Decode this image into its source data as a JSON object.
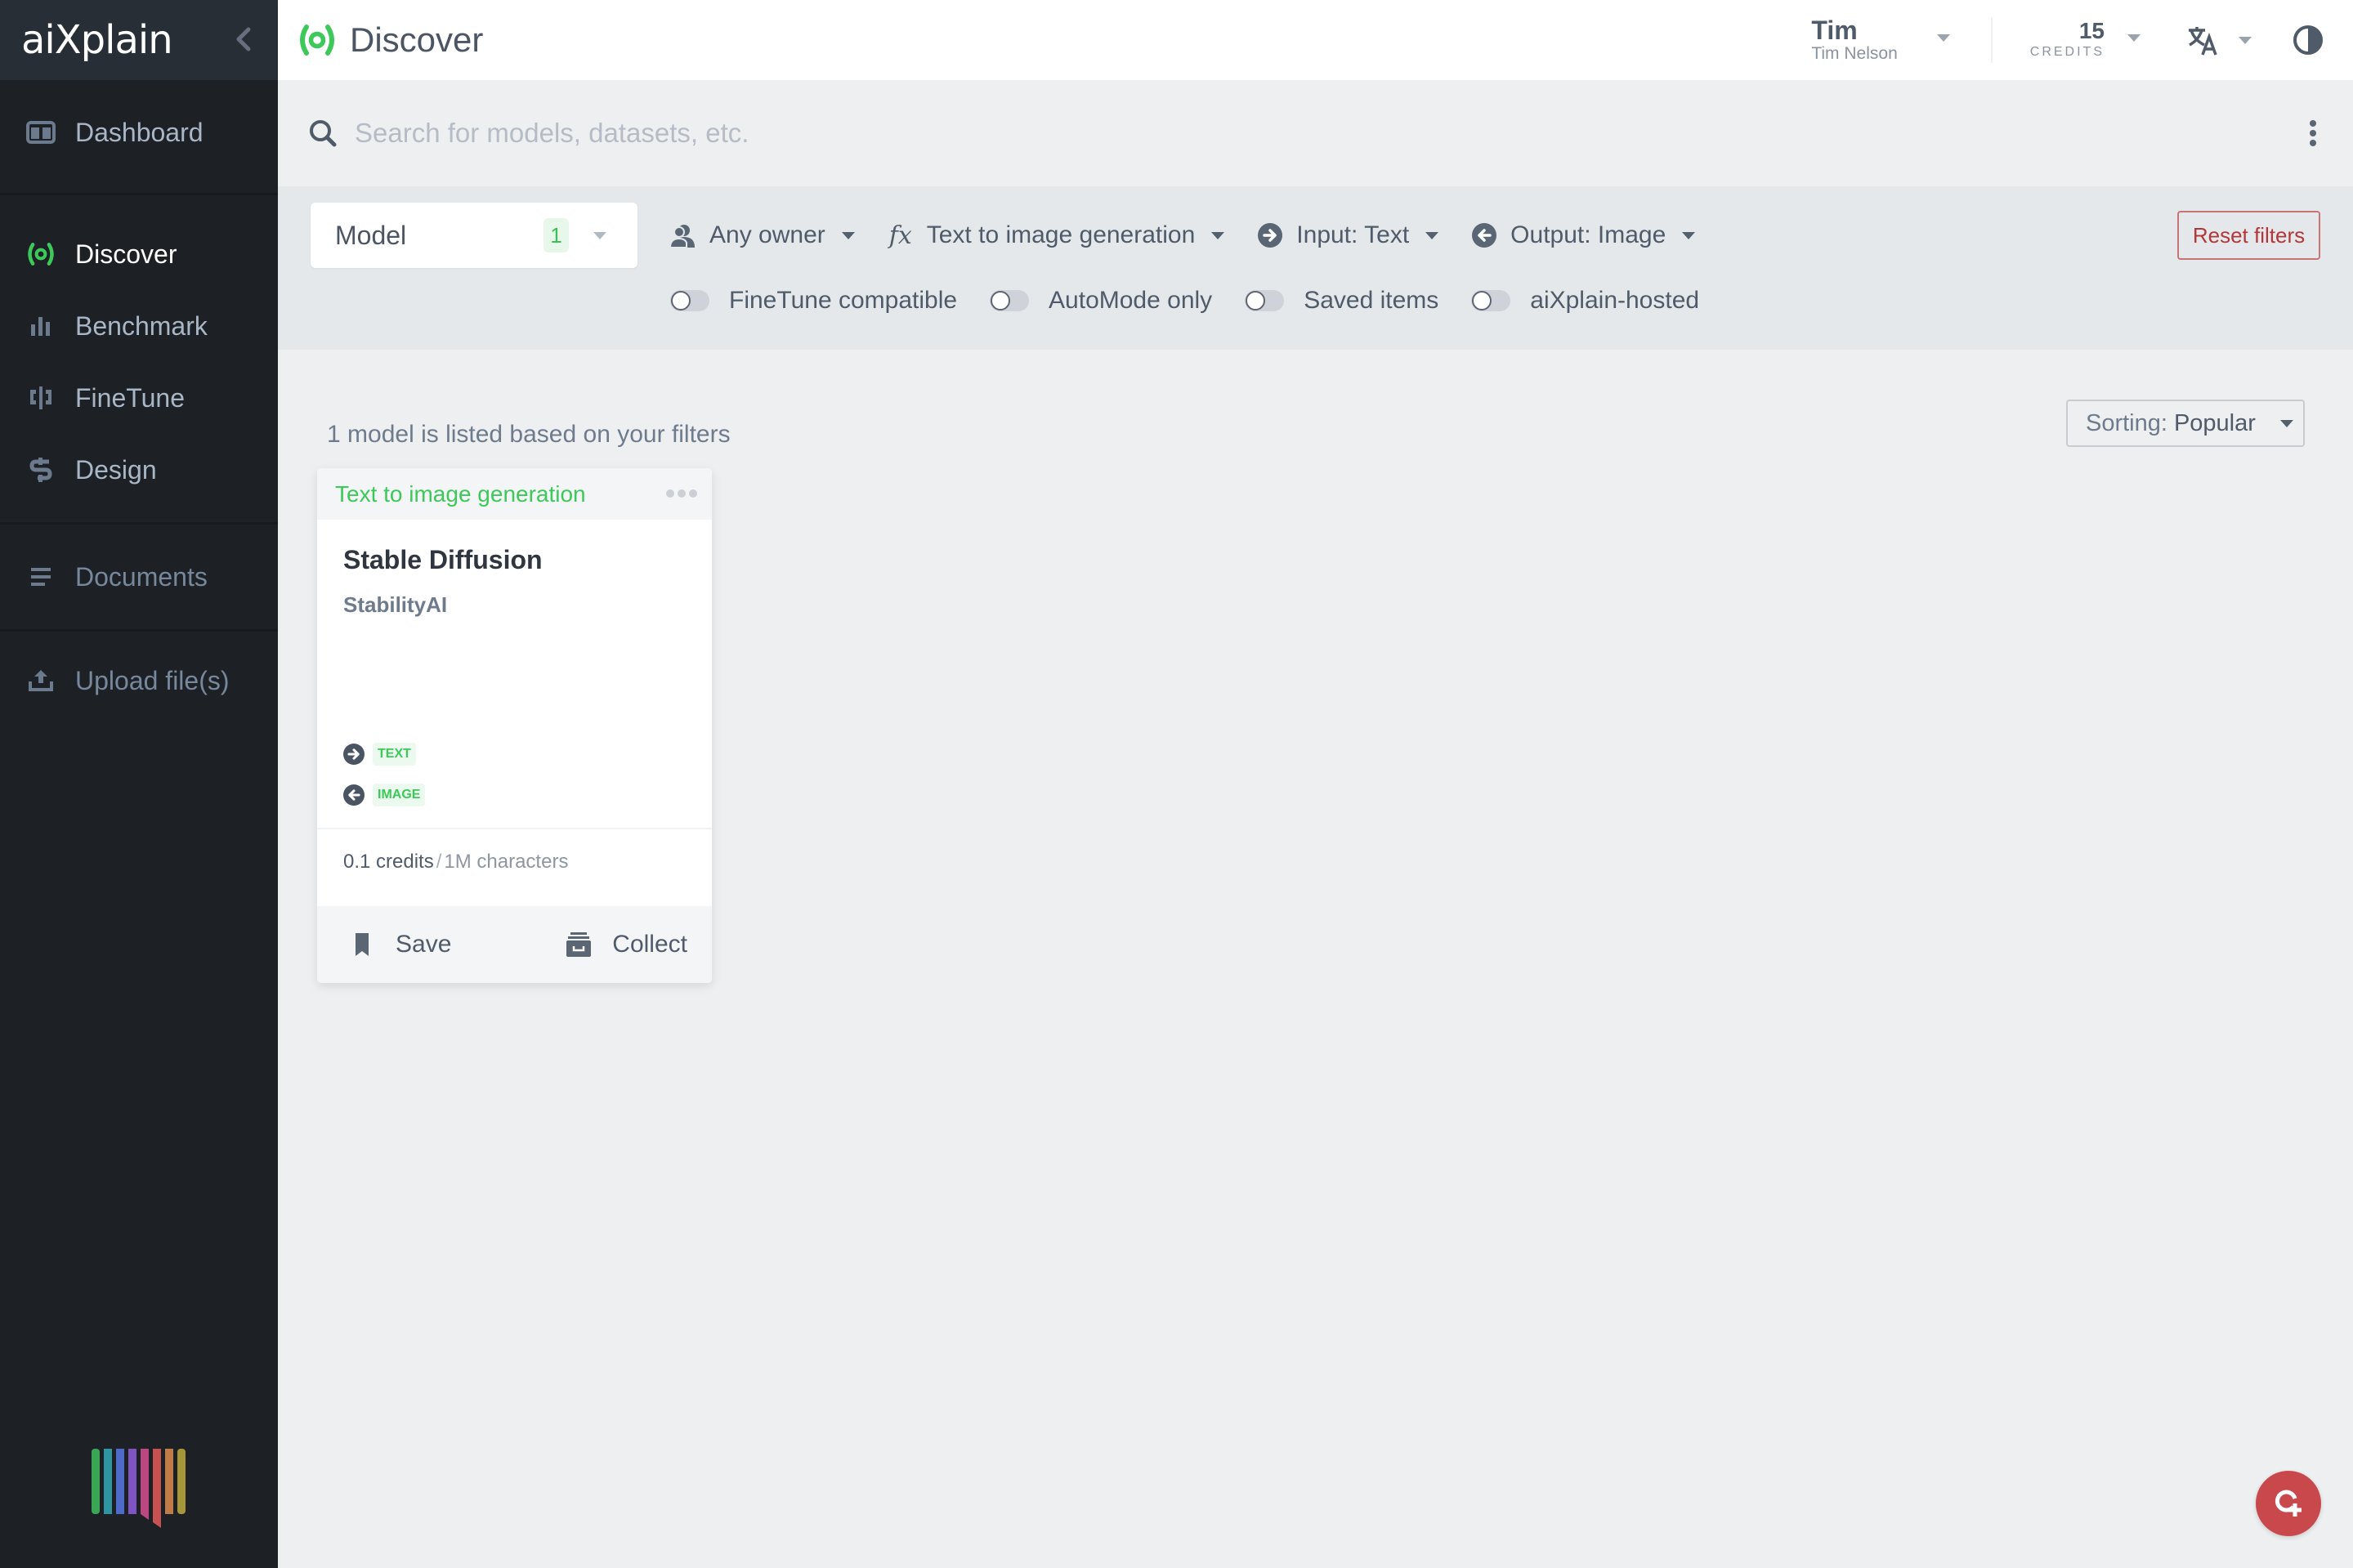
{
  "app": {
    "logo_text": "aiXplain",
    "page_title": "Discover",
    "brand_green": "#3dc95a"
  },
  "sidebar": {
    "items": [
      {
        "label": "Dashboard",
        "icon": "dashboard-icon",
        "active": false
      },
      {
        "label": "Discover",
        "icon": "discover-icon",
        "active": true
      },
      {
        "label": "Benchmark",
        "icon": "benchmark-icon",
        "active": false
      },
      {
        "label": "FineTune",
        "icon": "finetune-icon",
        "active": false
      },
      {
        "label": "Design",
        "icon": "design-icon",
        "active": false
      },
      {
        "label": "Documents",
        "icon": "documents-icon",
        "active": false
      },
      {
        "label": "Upload file(s)",
        "icon": "upload-icon",
        "active": false
      }
    ]
  },
  "header": {
    "user_short": "Tim",
    "user_full": "Tim Nelson",
    "credits_value": "15",
    "credits_label": "CREDITS"
  },
  "search": {
    "placeholder": "Search for models, datasets, etc.",
    "value": ""
  },
  "filters": {
    "type_select": {
      "label": "Model",
      "count": "1"
    },
    "dropdowns": [
      {
        "label": "Any owner",
        "icon": "owner-icon"
      },
      {
        "label": "Text to image generation",
        "icon": "function-icon"
      },
      {
        "label": "Input: Text",
        "icon": "input-arrow-icon"
      },
      {
        "label": "Output: Image",
        "icon": "output-arrow-icon"
      }
    ],
    "toggles": [
      {
        "label": "FineTune compatible",
        "on": false
      },
      {
        "label": "AutoMode only",
        "on": false
      },
      {
        "label": "Saved items",
        "on": false
      },
      {
        "label": "aiXplain-hosted",
        "on": false
      }
    ],
    "reset_label": "Reset filters"
  },
  "results": {
    "count_text": "1 model is listed based on your filters",
    "sort_key": "Sorting:",
    "sort_value": "Popular"
  },
  "cards": [
    {
      "function": "Text to image generation",
      "name": "Stable Diffusion",
      "vendor": "StabilityAI",
      "input": "TEXT",
      "output": "IMAGE",
      "price_amount": "0.1 credits",
      "price_sep": "/",
      "price_unit": "1M characters",
      "save_label": "Save",
      "collect_label": "Collect"
    }
  ]
}
